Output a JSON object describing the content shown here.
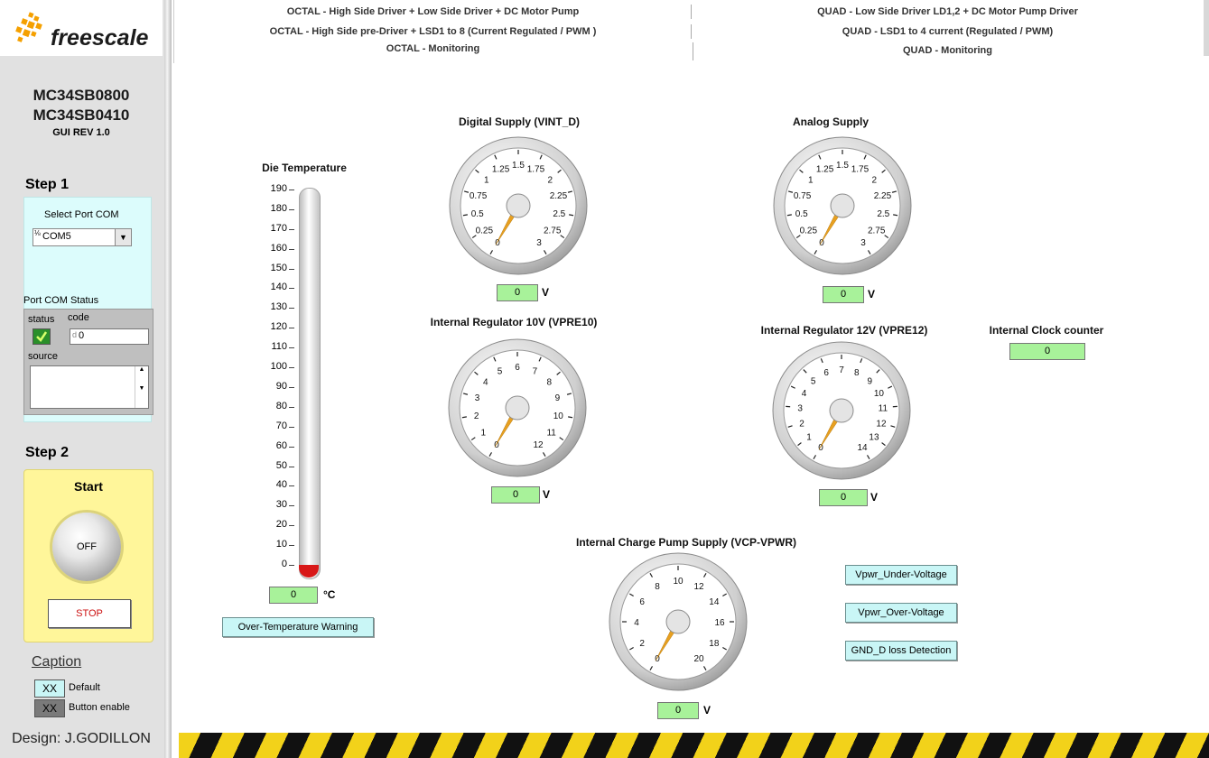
{
  "sidebar": {
    "logo": "freescale",
    "chip1": "MC34SB0800",
    "chip2": "MC34SB0410",
    "gui_rev": "GUI REV 1.0",
    "step1": "Step 1",
    "select_port_label": "Select Port COM",
    "port_value": "COM5",
    "port_status_label": "Port COM Status",
    "status_label": "status",
    "code_label": "code",
    "code_value": "0",
    "source_label": "source",
    "step2": "Step 2",
    "start_label": "Start",
    "knob_state": "OFF",
    "stop_label": "STOP",
    "caption_title": "Caption",
    "caption_default_swatch": "XX",
    "caption_default_label": "Default",
    "caption_enable_swatch": "XX",
    "caption_enable_label": "Button enable",
    "design": "Design: J.GODILLON"
  },
  "menu": {
    "octal": [
      "OCTAL - High Side Driver + Low Side Driver + DC Motor Pump",
      "OCTAL - High Side pre-Driver + LSD1 to 8 (Current Regulated / PWM )",
      "OCTAL - Monitoring"
    ],
    "quad": [
      "QUAD - Low Side Driver LD1,2 + DC Motor Pump Driver",
      "QUAD - LSD1 to 4 current (Regulated / PWM)",
      "QUAD - Monitoring"
    ]
  },
  "die_temp": {
    "title": "Die Temperature",
    "ticks": [
      "190",
      "180",
      "170",
      "160",
      "150",
      "140",
      "130",
      "120",
      "110",
      "100",
      "90",
      "80",
      "70",
      "60",
      "50",
      "40",
      "30",
      "20",
      "10",
      "0"
    ],
    "value": "0",
    "unit": "°C",
    "warning": "Over-Temperature Warning",
    "level": 0
  },
  "gauges": {
    "vint_d": {
      "title": "Digital Supply (VINT_D)",
      "labels": [
        "0",
        "0.25",
        "0.5",
        "0.75",
        "1",
        "1.25",
        "1.5",
        "1.75",
        "2",
        "2.25",
        "2.5",
        "2.75",
        "3"
      ],
      "value": "0",
      "unit": "V"
    },
    "analog": {
      "title": "Analog Supply",
      "labels": [
        "0",
        "0.25",
        "0.5",
        "0.75",
        "1",
        "1.25",
        "1.5",
        "1.75",
        "2",
        "2.25",
        "2.5",
        "2.75",
        "3"
      ],
      "value": "0",
      "unit": "V"
    },
    "vpre10": {
      "title": "Internal Regulator 10V (VPRE10)",
      "labels": [
        "0",
        "1",
        "2",
        "3",
        "4",
        "5",
        "6",
        "7",
        "8",
        "9",
        "10",
        "11",
        "12"
      ],
      "value": "0",
      "unit": "V"
    },
    "vpre12": {
      "title": "Internal Regulator 12V (VPRE12)",
      "labels": [
        "0",
        "1",
        "2",
        "3",
        "4",
        "5",
        "6",
        "7",
        "8",
        "9",
        "10",
        "11",
        "12",
        "13",
        "14"
      ],
      "value": "0",
      "unit": "V"
    },
    "vcp": {
      "title": "Internal Charge Pump Supply (VCP-VPWR)",
      "labels": [
        "0",
        "2",
        "4",
        "6",
        "8",
        "10",
        "12",
        "14",
        "16",
        "18",
        "20"
      ],
      "value": "0",
      "unit": "V"
    }
  },
  "clock": {
    "title": "Internal Clock counter",
    "value": "0"
  },
  "indicators": {
    "under": "Vpwr_Under-Voltage",
    "over": "Vpwr_Over-Voltage",
    "gnd": "GND_D loss Detection"
  },
  "colors": {
    "value_green": "#a8f29a",
    "indicator_cyan": "#c9f6f6",
    "step2_yellow": "#fff69a",
    "needle": "#e8a020",
    "thermo_red": "#d81818"
  }
}
